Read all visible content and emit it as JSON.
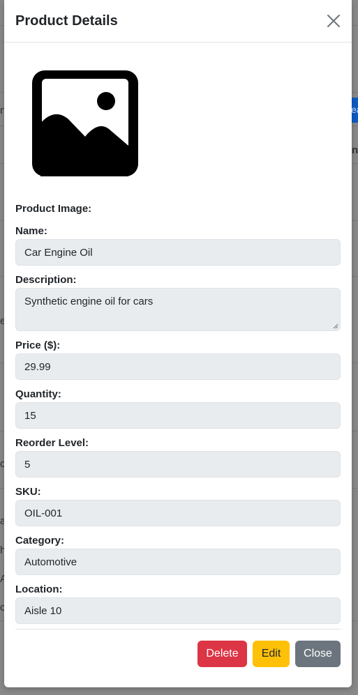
{
  "modal": {
    "title": "Product Details",
    "close_icon": "close-icon",
    "image_icon": "image-placeholder-icon",
    "image_label": "Product Image:"
  },
  "fields": {
    "name": {
      "label": "Name:",
      "value": "Car Engine Oil"
    },
    "description": {
      "label": "Description:",
      "value": "Synthetic engine oil for cars"
    },
    "price": {
      "label": "Price ($):",
      "value": "29.99"
    },
    "quantity": {
      "label": "Quantity:",
      "value": "15"
    },
    "reorder_level": {
      "label": "Reorder Level:",
      "value": "5"
    },
    "sku": {
      "label": "SKU:",
      "value": "OIL-001"
    },
    "category": {
      "label": "Category:",
      "value": "Automotive"
    },
    "location": {
      "label": "Location:",
      "value": "Aisle 10"
    }
  },
  "footer": {
    "delete_label": "Delete",
    "edit_label": "Edit",
    "close_label": "Close"
  },
  "colors": {
    "delete": "#dc3545",
    "edit": "#ffc107",
    "close": "#6c757d",
    "field_bg": "#e9ecef"
  },
  "backdrop": {
    "fragments": [
      "n",
      "ea",
      "nt",
      "es",
      "o",
      "as",
      "h",
      "A",
      "or"
    ]
  }
}
